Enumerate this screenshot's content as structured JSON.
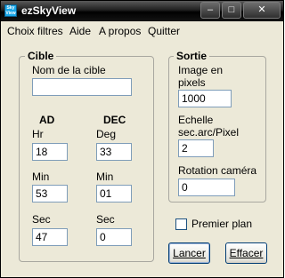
{
  "window": {
    "title": "ezSkyView",
    "icon_text": "Sky View",
    "controls": {
      "minimize": "–",
      "maximize": "□",
      "close": "✕"
    }
  },
  "menu": [
    "Choix filtres",
    "Aide",
    "A propos",
    "Quitter"
  ],
  "cible": {
    "legend": "Cible",
    "nom_label": "Nom de la cible",
    "nom_value": "",
    "ad_label": "AD",
    "dec_label": "DEC",
    "hr_label": "Hr",
    "hr_value": "18",
    "deg_label": "Deg",
    "deg_value": "33",
    "min_ad_label": "Min",
    "min_ad_value": "53",
    "min_dec_label": "Min",
    "min_dec_value": "01",
    "sec_ad_label": "Sec",
    "sec_ad_value": "47",
    "sec_dec_label": "Sec",
    "sec_dec_value": "0"
  },
  "sortie": {
    "legend": "Sortie",
    "image_label_1": "Image en",
    "image_label_2": "pixels",
    "image_value": "1000",
    "echelle_label_1": "Echelle",
    "echelle_label_2": "sec.arc/Pixel",
    "echelle_value": "2",
    "rotation_label": "Rotation caméra",
    "rotation_value": "0"
  },
  "premier_plan": {
    "label": "Premier plan",
    "checked": false
  },
  "buttons": {
    "lancer": "Lancer",
    "effacer": "Effacer"
  }
}
